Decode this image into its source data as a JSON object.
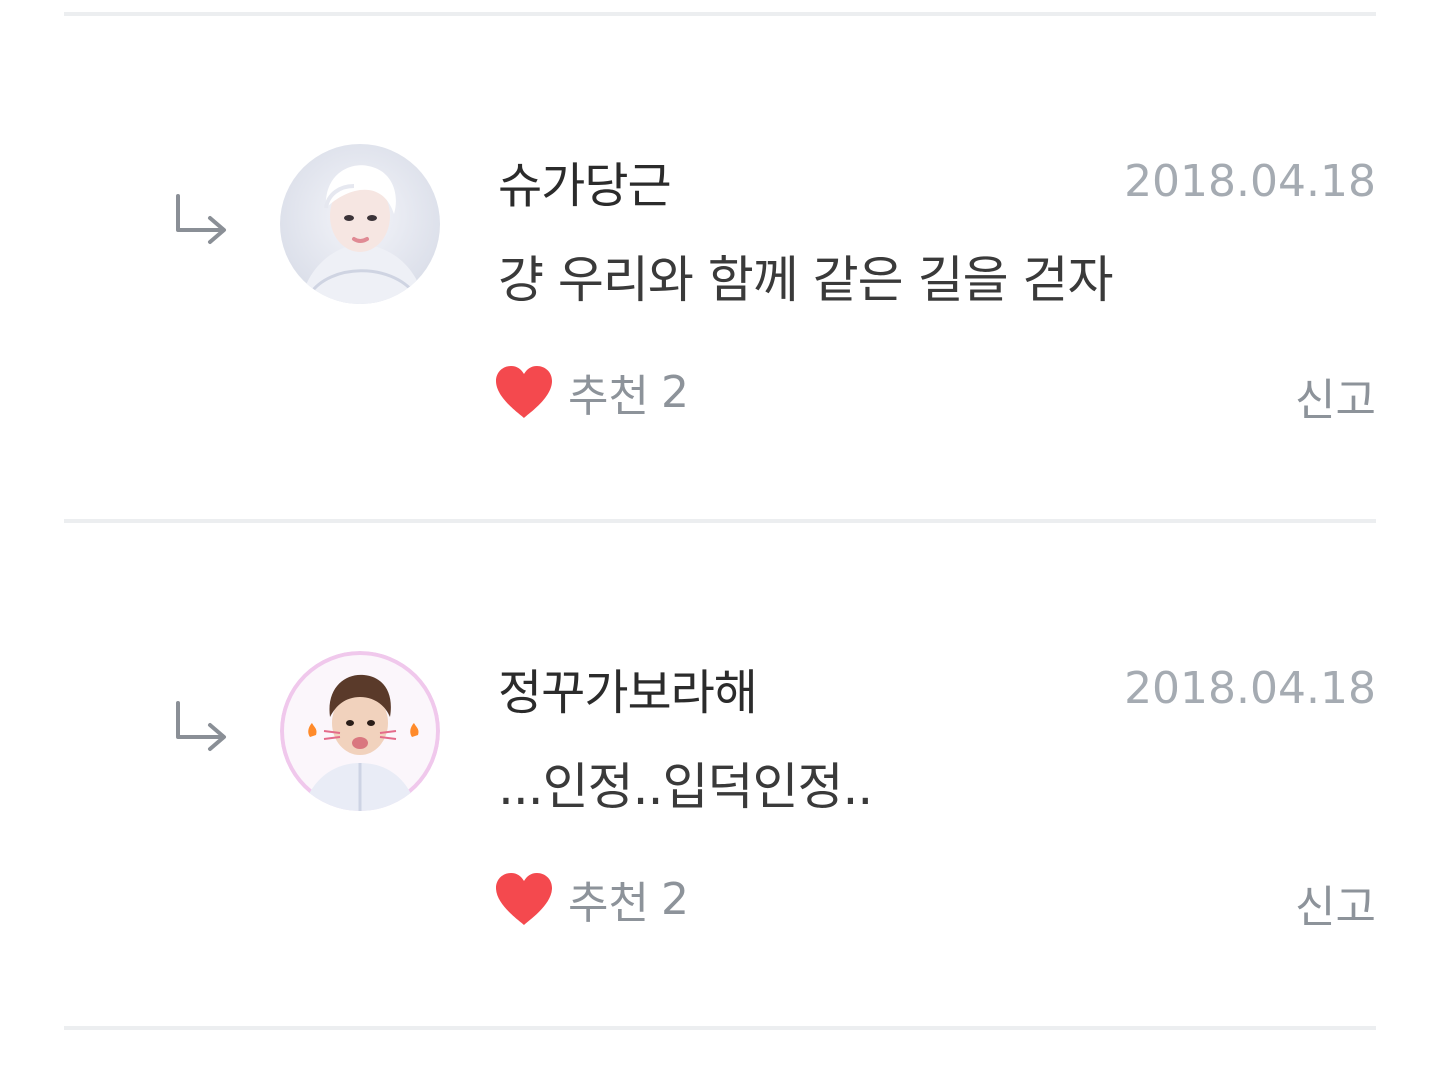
{
  "comments": [
    {
      "author": "슈가당근",
      "date": "2018.04.18",
      "text": "걍 우리와 함께 같은 길을 걷자",
      "like_label": "추천",
      "like_count": "2",
      "report_label": "신고",
      "avatar_icon": "user-avatar-photo"
    },
    {
      "author": "정꾸가보라해",
      "date": "2018.04.18",
      "text": "...인정..입덕인정..",
      "like_label": "추천",
      "like_count": "2",
      "report_label": "신고",
      "avatar_icon": "user-avatar-photo"
    }
  ],
  "icons": {
    "reply": "reply-arrow-icon",
    "like": "heart-icon"
  },
  "colors": {
    "heart": "#f4494e",
    "divider": "#eceef0",
    "muted": "#8d939a",
    "date": "#a5abb2"
  }
}
